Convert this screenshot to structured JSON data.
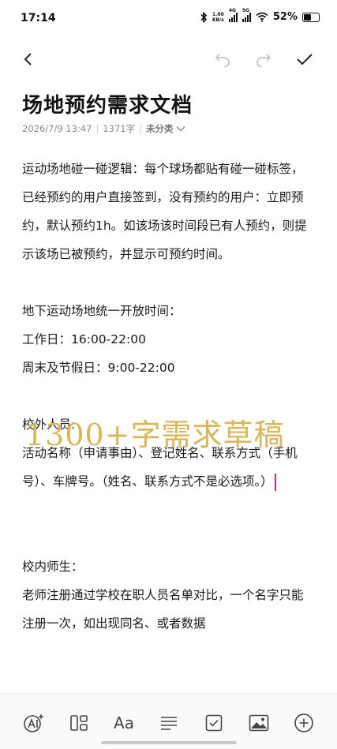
{
  "status_bar": {
    "time": "17:14",
    "net_speed_value": "1.60",
    "net_speed_unit": "KB/s",
    "signal1_label": "4G",
    "signal2_label": "5G",
    "battery_percent": "52%",
    "battery_level": 0.52
  },
  "toolbar": {
    "back_icon": "chevron-left",
    "undo_icon": "undo",
    "redo_icon": "redo",
    "done_icon": "check"
  },
  "note": {
    "title": "场地预约需求文档",
    "date": "2026/7/9 13:47",
    "word_count": "1371字",
    "category": "未分类",
    "paragraphs": [
      "运动场地碰一碰逻辑：每个球场都贴有碰一碰标签，已经预约的用户直接签到，没有预约的用户：立即预约，默认预约1h。如该场该时间段已有人预约，则提示该场已被预约，并显示可预约时间。",
      "",
      "地下运动场地统一开放时间：",
      "工作日：16:00-22:00",
      "周末及节假日：9:00-22:00",
      "",
      "校外人员:",
      "活动名称（申请事由）、登记姓名、联系方式（手机号）、车牌号。（姓名、联系方式不是必选项。）",
      "",
      "",
      "校内师生：",
      "老师注册通过学校在职人员名单对比，一个名字只能注册一次，如出现同名、或者数据"
    ]
  },
  "watermark": "1300+字需求草稿",
  "bottom_bar": {
    "icons": [
      "ai-icon",
      "layout-icon",
      "text-format-icon",
      "list-format-icon",
      "checkbox-icon",
      "image-icon",
      "add-icon"
    ],
    "text_format_label": "Aa"
  },
  "colors": {
    "cursor": "#e91e63",
    "watermark": "#d9b656",
    "meta_text": "#8a8a8a"
  }
}
